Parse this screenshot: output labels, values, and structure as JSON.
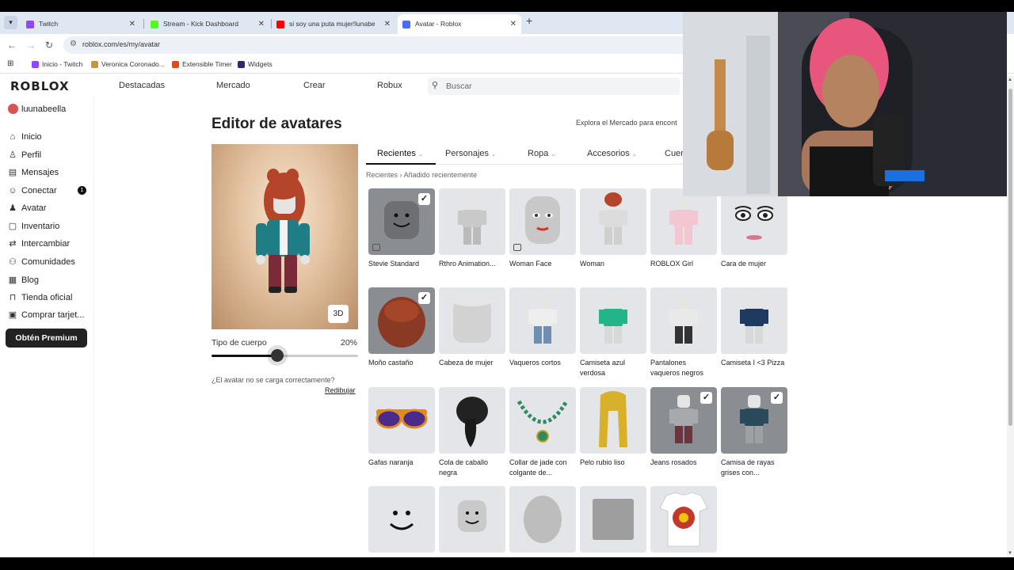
{
  "browser": {
    "tabs": [
      {
        "title": "Twitch",
        "favicon_color": "#9146ff"
      },
      {
        "title": "Stream - Kick Dashboard",
        "favicon_color": "#53fc18"
      },
      {
        "title": "si soy una puta mujer!lunabella",
        "favicon_color": "#ff0000"
      },
      {
        "title": "Avatar - Roblox",
        "favicon_color": "#4a6cf7"
      }
    ],
    "url": "roblox.com/es/my/avatar",
    "bookmarks": [
      {
        "label": "Inicio - Twitch",
        "color": "#9146ff"
      },
      {
        "label": "Veronica Coronado...",
        "color": "#c9953b"
      },
      {
        "label": "Extensible Timer",
        "color": "#e64a19"
      },
      {
        "label": "Widgets",
        "color": "#2b2b6b"
      }
    ]
  },
  "header": {
    "logo": "ROBLOX",
    "nav": [
      "Destacadas",
      "Mercado",
      "Crear",
      "Robux"
    ],
    "search_placeholder": "Buscar"
  },
  "sidebar": {
    "username": "luunabeella",
    "items": [
      {
        "label": "Inicio",
        "icon": "home-icon",
        "glyph": "⌂"
      },
      {
        "label": "Perfil",
        "icon": "profile-icon",
        "glyph": "♙"
      },
      {
        "label": "Mensajes",
        "icon": "messages-icon",
        "glyph": "▤"
      },
      {
        "label": "Conectar",
        "icon": "connect-icon",
        "glyph": "☺",
        "badge": "1"
      },
      {
        "label": "Avatar",
        "icon": "avatar-icon",
        "glyph": "♟"
      },
      {
        "label": "Inventario",
        "icon": "inventory-icon",
        "glyph": "▢"
      },
      {
        "label": "Intercambiar",
        "icon": "trade-icon",
        "glyph": "⇄"
      },
      {
        "label": "Comunidades",
        "icon": "communities-icon",
        "glyph": "⚇"
      },
      {
        "label": "Blog",
        "icon": "blog-icon",
        "glyph": "▦"
      },
      {
        "label": "Tienda oficial",
        "icon": "store-icon",
        "glyph": "⊓"
      },
      {
        "label": "Comprar tarjet...",
        "icon": "gift-card-icon",
        "glyph": "▣"
      }
    ],
    "premium_label": "Obtén Premium"
  },
  "main": {
    "title": "Editor de avatares",
    "explore_text": "Explora el Mercado para encont",
    "view_mode_label": "3D",
    "slider": {
      "label": "Tipo de cuerpo",
      "value_text": "20%",
      "value": 0.45
    },
    "help_text": "¿El avatar no se carga correctamente?",
    "redraw_label": "Redibujar",
    "category_tabs": [
      "Recientes",
      "Personajes",
      "Ropa",
      "Accesorios",
      "Cuer"
    ],
    "breadcrumb": [
      "Recientes",
      "Añadido recientemente"
    ],
    "items": [
      {
        "name": "Stevie Standard",
        "selected": true,
        "tag": true,
        "kind": "face-head"
      },
      {
        "name": "Rthro Animation...",
        "selected": false,
        "tag": false,
        "kind": "figure"
      },
      {
        "name": "Woman Face",
        "selected": false,
        "tag": true,
        "kind": "woman-face"
      },
      {
        "name": "Woman",
        "selected": false,
        "tag": false,
        "kind": "woman"
      },
      {
        "name": "ROBLOX Girl",
        "selected": false,
        "tag": false,
        "kind": "girl"
      },
      {
        "name": "Cara de mujer",
        "selected": false,
        "tag": false,
        "kind": "eyes"
      },
      {
        "name": "Moño castaño",
        "selected": true,
        "tag": false,
        "kind": "hair"
      },
      {
        "name": "Cabeza de mujer",
        "selected": false,
        "tag": false,
        "kind": "head"
      },
      {
        "name": "Vaqueros cortos",
        "selected": false,
        "tag": false,
        "kind": "shorts"
      },
      {
        "name": "Camiseta azul verdosa",
        "selected": false,
        "tag": false,
        "kind": "teal-shirt"
      },
      {
        "name": "Pantalones vaqueros negros",
        "selected": false,
        "tag": false,
        "kind": "black-jeans"
      },
      {
        "name": "Camiseta I <3 Pizza",
        "selected": false,
        "tag": false,
        "kind": "pizza-shirt"
      },
      {
        "name": "Gafas naranja",
        "selected": false,
        "tag": false,
        "kind": "glasses"
      },
      {
        "name": "Cola de caballo negra",
        "selected": false,
        "tag": false,
        "kind": "ponytail"
      },
      {
        "name": "Collar de jade con colgante de...",
        "selected": false,
        "tag": false,
        "kind": "necklace"
      },
      {
        "name": "Pelo rubio liso",
        "selected": false,
        "tag": false,
        "kind": "blonde"
      },
      {
        "name": "Jeans rosados",
        "selected": true,
        "tag": false,
        "kind": "pink-jeans"
      },
      {
        "name": "Camisa de rayas grises con...",
        "selected": true,
        "tag": false,
        "kind": "striped-shirt"
      },
      {
        "name": "",
        "selected": false,
        "tag": false,
        "kind": "smile"
      },
      {
        "name": "",
        "selected": false,
        "tag": false,
        "kind": "smile-head"
      },
      {
        "name": "",
        "selected": false,
        "tag": false,
        "kind": "round-head"
      },
      {
        "name": "",
        "selected": false,
        "tag": false,
        "kind": "block-head"
      },
      {
        "name": "",
        "selected": false,
        "tag": false,
        "kind": "tshirt"
      }
    ]
  },
  "colors": {
    "accent": "#222222",
    "tile_bg": "#e3e5e8",
    "selected_tile_bg": "#8a8d91"
  }
}
